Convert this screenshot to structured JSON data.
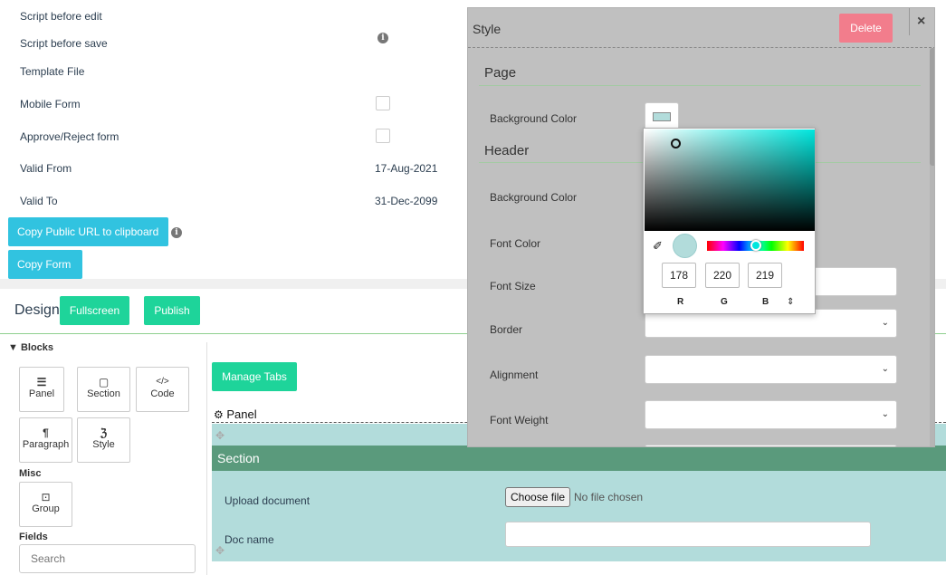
{
  "form_settings": {
    "script_before_edit": "Script before edit",
    "script_before_save": "Script before save",
    "template_file": "Template File",
    "mobile_form": "Mobile Form",
    "approve_reject_form": "Approve/Reject form",
    "valid_from_label": "Valid From",
    "valid_from_value": "17-Aug-2021",
    "valid_to_label": "Valid To",
    "valid_to_value": "31-Dec-2099",
    "copy_public_url": "Copy Public URL to clipboard",
    "copy_form": "Copy Form",
    "info_glyph": "i"
  },
  "design_bar": {
    "title": "Design",
    "fullscreen": "Fullscreen",
    "publish": "Publish"
  },
  "blocks": {
    "header": "▼ Blocks",
    "items": [
      {
        "icon": "☰",
        "label": "Panel"
      },
      {
        "icon": "▢",
        "label": "Section"
      },
      {
        "icon": "</>",
        "label": "Code"
      },
      {
        "icon": "¶",
        "label": "Paragraph"
      },
      {
        "icon": "ℨ",
        "label": "Style"
      }
    ],
    "misc_header": "Misc",
    "group": {
      "icon": "⊡",
      "label": "Group"
    },
    "fields_header": "Fields",
    "search_placeholder": "Search"
  },
  "canvas": {
    "manage_tabs": "Manage Tabs",
    "panel_label": "Panel",
    "section_title": "Section",
    "upload_label": "Upload document",
    "choose_file": "Choose file",
    "no_file": "No file chosen",
    "doc_name_label": "Doc name",
    "doc_name_value": ""
  },
  "style_modal": {
    "title": "Style",
    "delete": "Delete",
    "close": "×",
    "page_header": "Page",
    "page_bg_label": "Background Color",
    "header_header": "Header",
    "header_bg_label": "Background Color",
    "font_color_label": "Font Color",
    "font_size_label": "Font Size",
    "border_label": "Border",
    "alignment_label": "Alignment",
    "font_weight_label": "Font Weight"
  },
  "color_picker": {
    "r": "178",
    "g": "220",
    "b": "219",
    "r_label": "R",
    "g_label": "G",
    "b_label": "B",
    "mode_toggle": "⇕",
    "swatch_color": "#b2dcdb",
    "hue_color": "#00e6dd"
  },
  "colors": {
    "cyan_button": "#31c3e0",
    "green_button": "#1ed49a",
    "delete_button": "#f27d8c",
    "section_header": "#5a9a7c",
    "section_body": "#b2dcdb"
  }
}
